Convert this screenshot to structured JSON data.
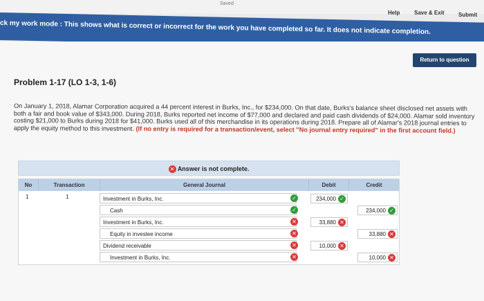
{
  "top": {
    "saved": "Saved",
    "help": "Help",
    "save_exit": "Save & Exit",
    "submit": "Submit"
  },
  "banner": {
    "text": "ck my work mode : This shows what is correct or incorrect for the work you have completed so far. It does not indicate completion."
  },
  "return_label": "Return to question",
  "problem": {
    "title": "Problem 1-17 (LO 1-3, 1-6)",
    "text": "On January 1, 2018, Alamar Corporation acquired a 44 percent interest in Burks, Inc., for $234,000. On that date, Burks's balance sheet disclosed net assets with both a fair and book value of $343,000. During 2018, Burks reported net income of $77,000 and declared and paid cash dividends of $24,000. Alamar sold inventory costing $21,000 to Burks during 2018 for $41,000. Burks used all of this merchandise in its operations during 2018. Prepare all of Alamar's 2018 journal entries to apply the equity method to this investment.",
    "instruction": "(If no entry is required for a transaction/event, select \"No journal entry required\" in the first account field.)"
  },
  "answer_status": "Answer is not complete.",
  "table": {
    "headers": {
      "no": "No",
      "transaction": "Transaction",
      "journal": "General Journal",
      "debit": "Debit",
      "credit": "Credit"
    },
    "no": "1",
    "transaction": "1",
    "rows": [
      {
        "account": "Investment in Burks, Inc.",
        "debit": "234,000",
        "credit": "",
        "status": "correct",
        "indent": false
      },
      {
        "account": "Cash",
        "debit": "",
        "credit": "234,000",
        "status": "correct",
        "indent": true
      },
      {
        "account": "Investment in Burks, Inc.",
        "debit": "33,880",
        "credit": "",
        "status": "incorrect",
        "indent": false
      },
      {
        "account": "Equity in investee income",
        "debit": "",
        "credit": "33,880",
        "status": "incorrect",
        "indent": true
      },
      {
        "account": "Dividend receivable",
        "debit": "10,000",
        "credit": "",
        "status": "incorrect",
        "indent": false
      },
      {
        "account": "Investment in Burks, Inc.",
        "debit": "",
        "credit": "10,000",
        "status": "incorrect",
        "indent": true
      }
    ]
  },
  "colors": {
    "banner": "#2f5fa2",
    "correct": "#2e9d3a",
    "incorrect": "#d93a3a"
  }
}
